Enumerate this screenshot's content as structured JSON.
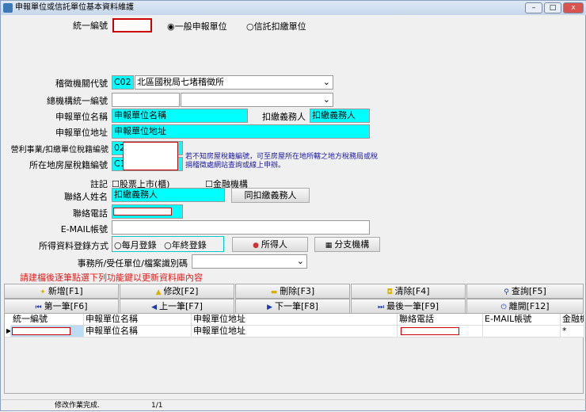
{
  "window": {
    "title": "申報單位或信託單位基本資料維護",
    "min": "–",
    "max": "□",
    "close": "x"
  },
  "form": {
    "uid_label": "統一編號",
    "uid_value": "",
    "radio1": "一般申報單位",
    "radio2": "信託扣繳單位",
    "office_label": "稽徵機關代號",
    "office_code": "C02",
    "office_name": "北區國稅局七堵稽徵所",
    "hq_label": "總機構統一編號",
    "name_label": "申報單位名稱",
    "name_value": "申報單位名稱",
    "agent_label": "扣繳義務人",
    "agent_value": "扣繳義務人",
    "addr_label": "申報單位地址",
    "addr_value": "申報單位地址",
    "biz_label": "營利事業/扣繳單位稅籍編號",
    "biz_prefix": "02",
    "house_label": "所在地房屋稅籍編號",
    "house_prefix": "C1",
    "hint": "若不知房屋稅籍編號，可至房屋所在地所轄之地方稅務局或稅捐稽徵處網站查詢或線上申辦。",
    "note_label": "註記",
    "chk1": "股票上市(櫃)",
    "chk2": "金融機構",
    "contact_label": "聯絡人姓名",
    "contact_value": "扣繳義務人",
    "same_btn": "同扣繳義務人",
    "phone_label": "聯絡電話",
    "email_label": "E-MAIL帳號",
    "method_label": "所得資料登錄方式",
    "method1": "每月登錄",
    "method2": "年終登錄",
    "income_btn": "所得人",
    "branch_btn": "分支機構",
    "firm_label": "事務所/受任單位/檔案識別碼",
    "warning": "請建檔後逐筆點選下列功能鍵以更新資料庫內容"
  },
  "buttons": [
    "新增[F1]",
    "修改[F2]",
    "刪除[F3]",
    "清除[F4]",
    "查詢[F5]",
    "第一筆[F6]",
    "上一筆[F7]",
    "下一筆[F8]",
    "最後一筆[F9]",
    "離開[F12]"
  ],
  "grid": {
    "headers": [
      "統一編號",
      "申報單位名稱",
      "申報單位地址",
      "聯絡電話",
      "E-MAIL帳號",
      "金融機"
    ],
    "row": [
      "",
      "申報單位名稱",
      "申報單位地址",
      "",
      "",
      ""
    ],
    "newrow": "*"
  },
  "status": {
    "message": "修改作業完成.",
    "page": "1/1"
  },
  "colors": {
    "accent": "#00ffff",
    "warning": "#e02020",
    "hint": "#1a1aa0"
  }
}
